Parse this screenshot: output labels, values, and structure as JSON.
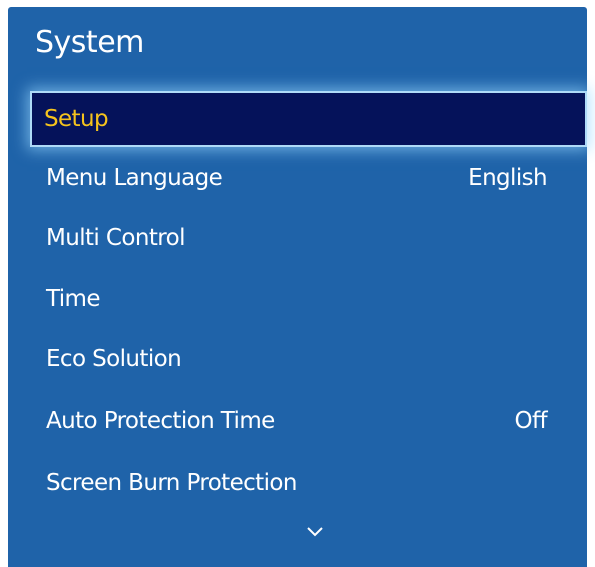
{
  "menu": {
    "title": "System",
    "items": [
      {
        "label": "Setup",
        "value": ""
      },
      {
        "label": "Menu Language",
        "value": "English"
      },
      {
        "label": "Multi Control",
        "value": ""
      },
      {
        "label": "Time",
        "value": ""
      },
      {
        "label": "Eco Solution",
        "value": ""
      },
      {
        "label": "Auto Protection Time",
        "value": "Off"
      },
      {
        "label": "Screen Burn Protection",
        "value": ""
      }
    ],
    "selected_index": 0,
    "more_icon": "chevron-down-icon"
  },
  "colors": {
    "panel_background": "#1f63a9",
    "selected_background": "#05125a",
    "selected_text": "#f5c31d",
    "text": "#ffffff"
  }
}
